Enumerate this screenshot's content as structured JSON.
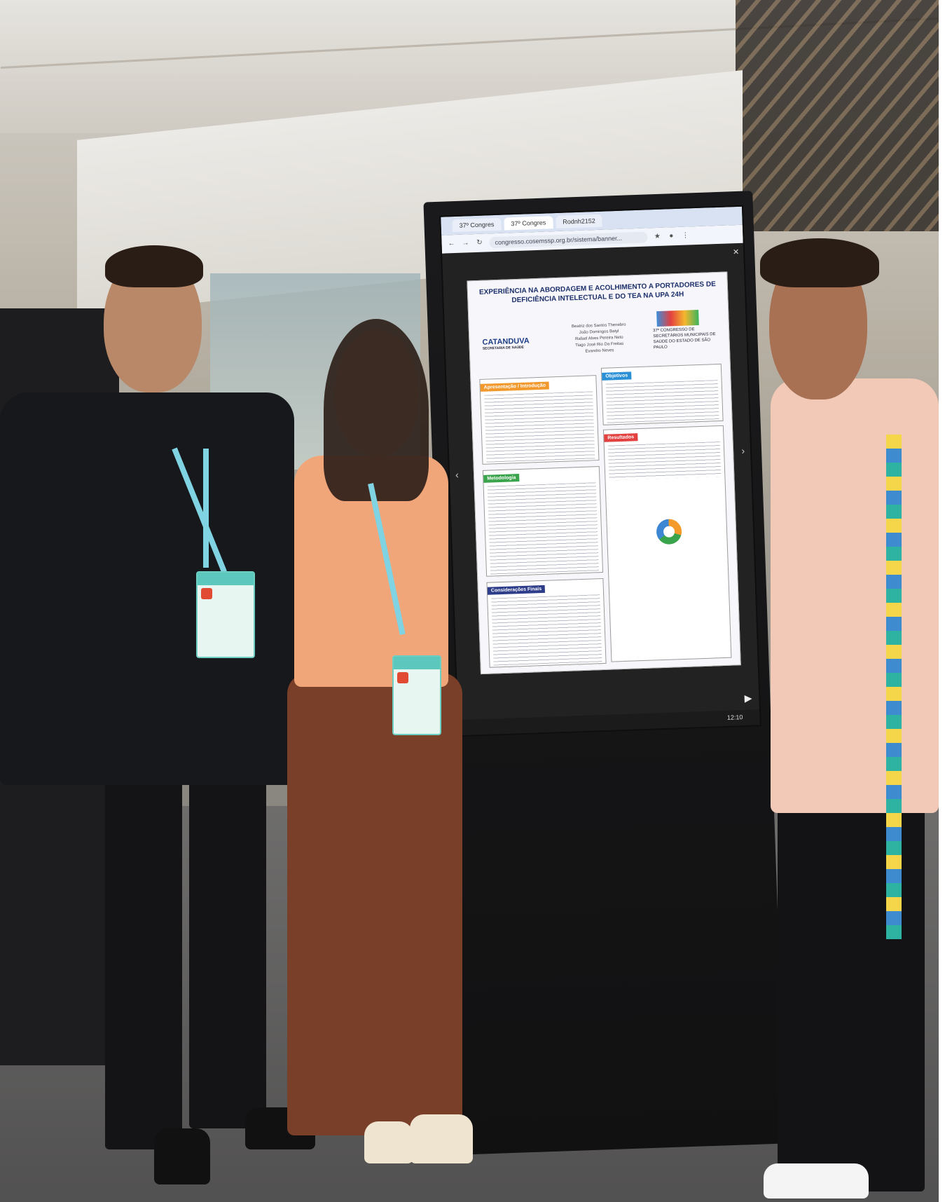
{
  "browser": {
    "tabs": [
      "37º Congres",
      "37º Congres",
      "Rodnh2152"
    ],
    "url": "congresso.cosemssp.org.br/sistema/banner..."
  },
  "poster": {
    "title": "EXPERIÊNCIA NA ABORDAGEM E ACOLHIMENTO A PORTADORES DE DEFICIÊNCIA INTELECTUAL E DO TEA NA UPA 24H",
    "logo": "CATANDUVA",
    "logo_sub": "SECRETARIA DE SAÚDE",
    "authors": [
      "Beatriz dos Santos Thenebro",
      "João Domingos Batyl",
      "Rafael Alves Pereira Neto",
      "Tiago José Rio Da Freitas",
      "Evandro Neves"
    ],
    "congress": "37º CONGRESSO DE SECRETÁRIOS MUNICIPAIS DE SAÚDE DO ESTADO DE SÃO PAULO",
    "sections": {
      "intro": "Apresentação / Introdução",
      "objectives": "Objetivos",
      "method": "Metodologia",
      "results": "Resultados",
      "final": "Considerações Finais"
    }
  },
  "taskbar": {
    "time": "12:10"
  },
  "colors": {
    "kiosk": "#151516",
    "badge_accent": "#5cc8bd",
    "lanyard": "#7fd3e2"
  },
  "icons": [
    "back-arrow-icon",
    "forward-arrow-icon",
    "refresh-icon",
    "star-icon",
    "profile-icon",
    "menu-dots-icon",
    "close-icon",
    "prev-slide-icon",
    "next-slide-icon",
    "play-icon"
  ]
}
